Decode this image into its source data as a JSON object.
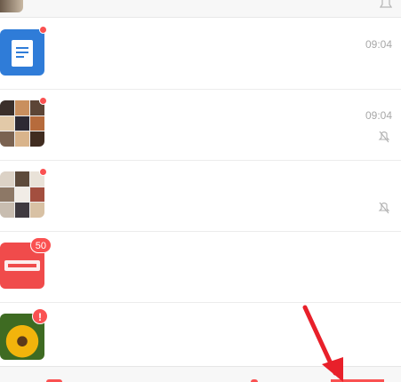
{
  "colors": {
    "accent_red": "#fa5151",
    "arrow_red": "#e8202a",
    "doc_blue": "#2f7cd8"
  },
  "chats": [
    {
      "title": "",
      "preview": "",
      "time": "09:04",
      "avatar": "document-icon",
      "badge": "dot",
      "muted": false
    },
    {
      "title": "",
      "preview": "",
      "time": "09:04",
      "avatar": "group-mosaic",
      "badge": "dot",
      "muted": true
    },
    {
      "title": "",
      "preview": "",
      "time": "",
      "avatar": "group-mosaic",
      "badge": "dot",
      "muted": true
    },
    {
      "title": "",
      "preview": "",
      "time": "",
      "avatar": "brand-logo",
      "badge": "50",
      "muted": false
    },
    {
      "title": "",
      "preview": "",
      "time": "",
      "avatar": "sunflower-photo",
      "badge": "!",
      "muted": false
    }
  ]
}
